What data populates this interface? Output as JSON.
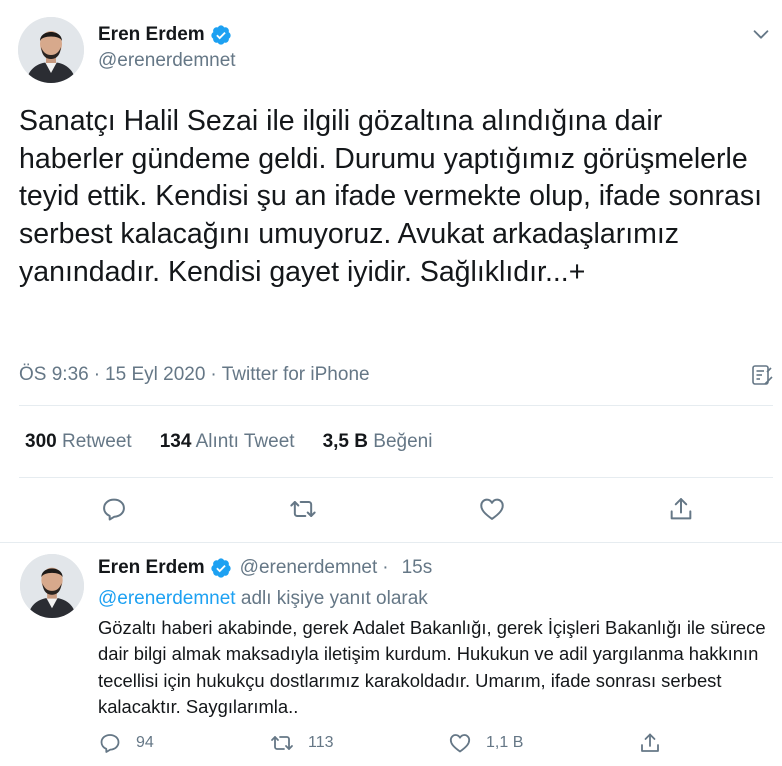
{
  "main_tweet": {
    "author": {
      "display_name": "Eren Erdem",
      "handle": "@erenerdemnet",
      "verified": true
    },
    "text": "Sanatçı Halil Sezai ile ilgili gözaltına alındığına dair haberler gündeme geldi. Durumu yaptığımız görüşmelerle teyid ettik. Kendisi şu an ifade vermekte olup, ifade sonrası serbest kalacağını umuyoruz. Avukat arkadaşlarımız yanındadır. Kendisi gayet iyidir. Sağlıklıdır...+",
    "time": "ÖS 9:36",
    "date": "15 Eyl 2020",
    "source": "Twitter for iPhone",
    "separator": "·",
    "stats": {
      "retweets_count": "300",
      "retweets_label": "Retweet",
      "quotes_count": "134",
      "quotes_label": "Alıntı Tweet",
      "likes_count": "3,5 B",
      "likes_label": "Beğeni"
    },
    "icons": [
      "chevron-down-icon",
      "analytics-icon",
      "reply-icon",
      "retweet-icon",
      "like-icon",
      "share-icon"
    ]
  },
  "reply_tweet": {
    "author": {
      "display_name": "Eren Erdem",
      "handle": "@erenerdemnet",
      "verified": true
    },
    "dot": "·",
    "age": "15s",
    "replying_to_mention": "@erenerdemnet",
    "replying_to_suffix": " adlı kişiye yanıt olarak",
    "text": "Gözaltı haberi akabinde, gerek Adalet Bakanlığı, gerek İçişleri Bakanlığı ile sürece dair bilgi almak maksadıyla iletişim kurdum. Hukukun ve adil yargılanma hakkının tecellisi için hukukçu dostlarımız karakoldadır. Umarım, ifade sonrası serbest kalacaktır. Saygılarımla..",
    "actions": {
      "replies": "94",
      "retweets": "113",
      "likes": "1,1 B"
    }
  },
  "colors": {
    "text_primary": "#14171a",
    "text_secondary": "#657786",
    "accent": "#1da1f2",
    "divider": "#e6ecf0"
  }
}
